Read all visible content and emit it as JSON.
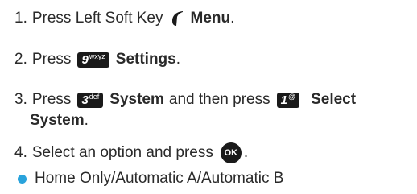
{
  "steps": [
    {
      "num": "1.",
      "text": "Press Left Soft Key",
      "bold": "Menu",
      "end": "."
    },
    {
      "num": "2.",
      "text": "Press",
      "key": "9",
      "key_sub": "wxyz",
      "bold": "Settings",
      "end": "."
    },
    {
      "num": "3.",
      "text": "Press",
      "key": "3",
      "key_sub": "def",
      "bold": "System",
      "mid": "and then press",
      "key2": "1",
      "key2_sub": "@",
      "bold2": "Select",
      "bold2_cont": "System",
      "end": "."
    },
    {
      "num": "4.",
      "text": "Select an option and press",
      "ok": "OK",
      "end": "."
    }
  ],
  "bullet": {
    "text": "Home Only/Automatic A/Automatic B",
    "color": "#29a3dc"
  },
  "icons": {
    "softkey": "left-soft-key-icon",
    "ok": "ok-button-icon"
  }
}
